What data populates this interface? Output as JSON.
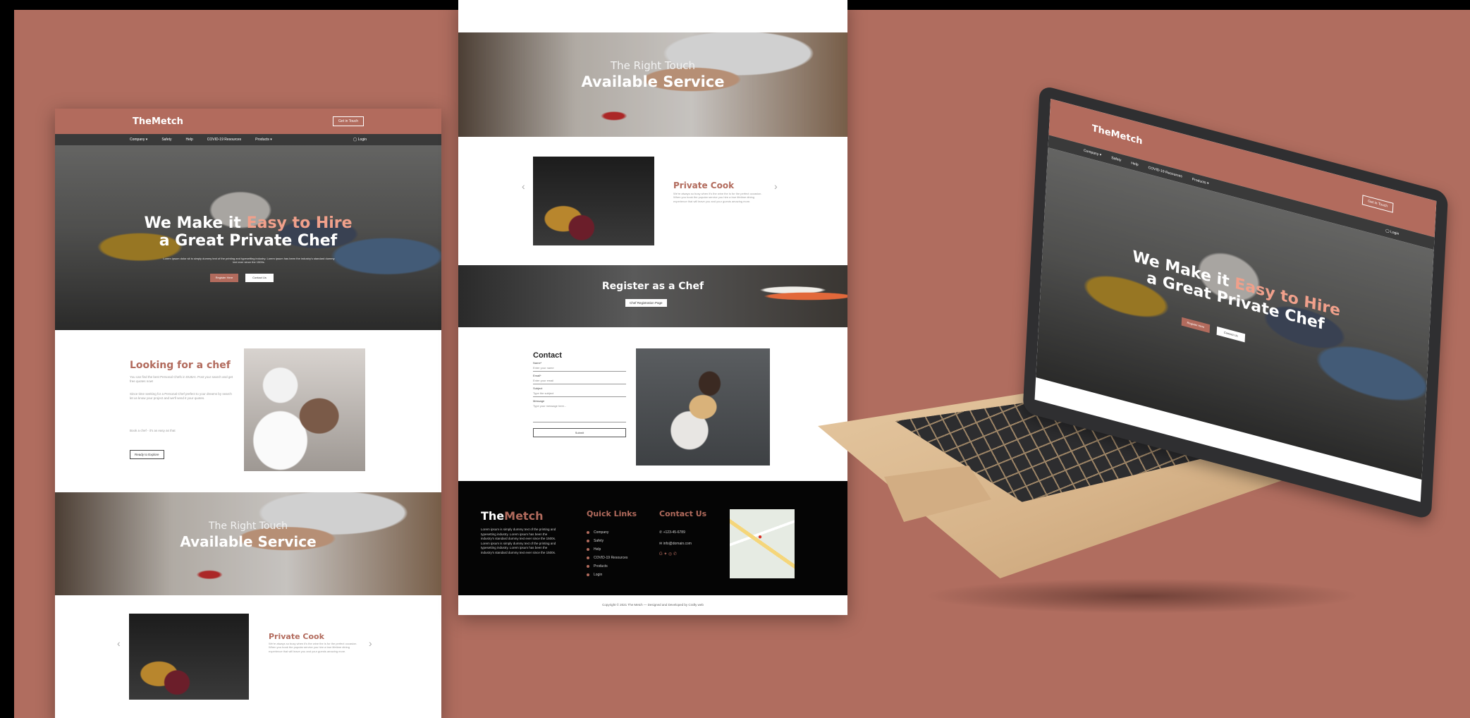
{
  "brand": {
    "logo_prefix": "The",
    "logo_name": "Metch",
    "accent_color": "#b26b5d"
  },
  "header": {
    "get_in_touch": "Get in Touch"
  },
  "nav": {
    "items": [
      "Company ▾",
      "Safety",
      "Help",
      "COVID-19 Resources",
      "Products ▾"
    ],
    "login": "Login"
  },
  "hero": {
    "title_part1": "We Make it ",
    "title_accent": "Easy to Hire",
    "title_line2": "a Great Private Chef",
    "subtitle": "Lorem ipsum dolor sit is simply dummy text of the printing and typesetting industry. Lorem ipsum has been the industry's standard dummy text ever since the 1500s.",
    "primary_button": "Register Here",
    "secondary_button": "Contact Us"
  },
  "looking": {
    "title": "Looking for a chef",
    "intro": "You can find the best Personal Chefs in DUBAI. Post your search and get free quotes now!",
    "body": "Since time seeking for a Personal Chef prefect to your dreams by search let us know your project and we'll send it your quotes.",
    "tagline": "Book a chef - it's as easy as that",
    "button": "Ready to Explore"
  },
  "service": {
    "kicker": "The Right Touch",
    "title": "Available Service"
  },
  "private_cook": {
    "title": "Private Cook",
    "text": "We're always so busy when it's the wine the is for the perfect occasion. When you book the popular service you hire a true lifetime dining experience that will leave you and your guests amazing more.",
    "prev": "‹",
    "next": "›"
  },
  "register": {
    "title": "Register as a Chef",
    "button": "Chef Registration Page"
  },
  "contact": {
    "title": "Contact",
    "name_label": "Name*",
    "name_placeholder": "Enter your name",
    "email_label": "Email*",
    "email_placeholder": "Enter your email",
    "subject_label": "Subject",
    "subject_placeholder": "Type the subject",
    "message_label": "Message",
    "message_placeholder": "Type your message here...",
    "submit": "Submit"
  },
  "footer": {
    "about": "Lorem ipsum is simply dummy text of the printing and typesetting industry. Lorem ipsum has been the industry's standard dummy text ever since the 1500s. Lorem ipsum is simply dummy text of the printing and typesetting industry. Lorem ipsum has been the industry's standard dummy text ever since the 1500s.",
    "quick_links_title": "Quick Links",
    "quick_links": [
      "Company",
      "Safety",
      "Help",
      "COVID-19 Resources",
      "Products",
      "Login"
    ],
    "contact_title": "Contact Us",
    "phone": "+123-45-6789",
    "email": "info@domain.com",
    "copyright": "Copyright © 2021 The Metch — Designed and Developed by Crafty web"
  },
  "icons": {
    "login": "user-icon",
    "phone": "phone-icon",
    "email": "mail-icon",
    "map_pin": "map-pin-icon"
  }
}
